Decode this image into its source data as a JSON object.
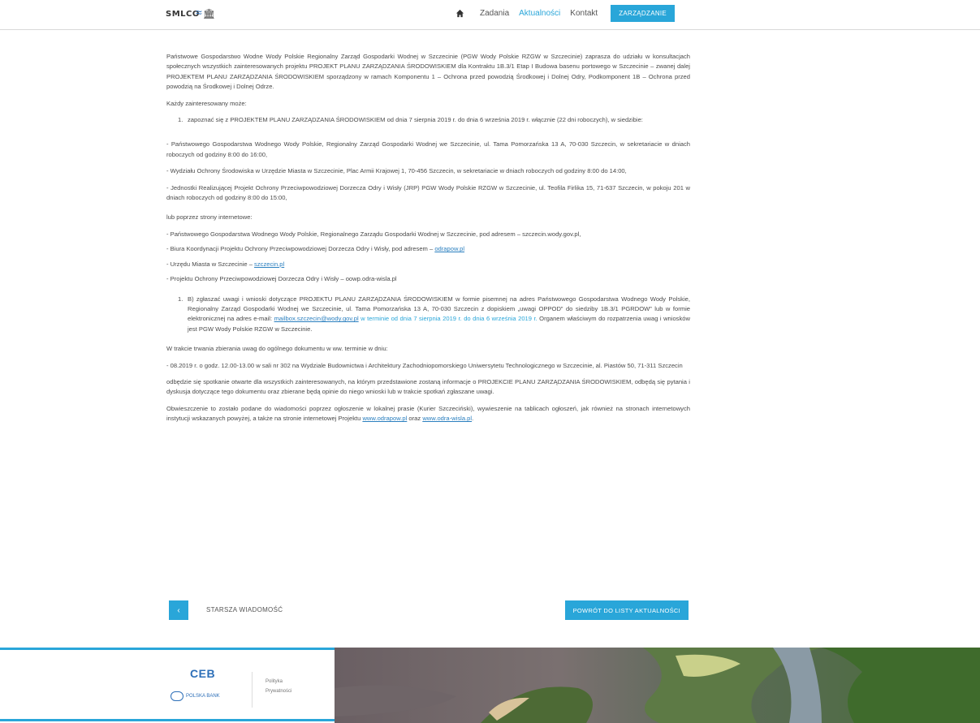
{
  "header": {
    "logo_text": "SMLCO",
    "nav": {
      "items": [
        "Zadania",
        "Aktualności",
        "Kontakt"
      ],
      "active_index": 1,
      "cta_label": "ZARZĄDZANIE"
    }
  },
  "article": {
    "intro": "Państwowe Gospodarstwo Wodne Wody Polskie Regionalny Zarząd Gospodarki Wodnej w Szczecinie (PGW Wody Polskie RZGW w Szczecinie) zaprasza do udziału w konsultacjach społecznych wszystkich zainteresowanych projektu PROJEKT PLANU ZARZĄDZANIA ŚRODOWISKIEM dla Kontraktu 1B.3/1 Etap I Budowa basenu portowego w Szczecinie – zwanej dalej PROJEKTEM PLANU ZARZĄDZANIA ŚRODOWISKIEM sporządzony w ramach Komponentu 1 – Ochrona przed powodzią Środkowej i Dolnej Odry, Podkomponent 1B – Ochrona przed powodzią na Środkowej i Dolnej Odrze.",
    "each_can": "Każdy zainteresowany może:",
    "point1": "zapoznać się z PROJEKTEM PLANU ZARZĄDZANIA ŚRODOWISKIEM od dnia 7 sierpnia 2019 r. do dnia 6 września 2019 r. włącznie (22 dni roboczych), w siedzibie:",
    "loc1": "- Państwowego Gospodarstwa Wodnego Wody Polskie, Regionalny Zarząd Gospodarki Wodnej we Szczecinie, ul. Tama Pomorzańska 13 A, 70-030 Szczecin, w sekretariacie w dniach roboczych od godziny 8:00 do 16:00,",
    "loc2": "- Wydziału Ochrony Środowiska w Urzędzie Miasta w Szczecinie, Plac Armii Krajowej 1, 70-456 Szczecin, w sekretariacie w dniach roboczych od godziny 8:00 do 14:00,",
    "loc3": "- Jednostki Realizującej Projekt Ochrony Przeciwpowodziowej Dorzecza Odry i Wisły (JRP) PGW Wody Polskie RZGW w Szczecinie, ul. Teofila Firlika 15, 71-637 Szczecin, w pokoju 201 w dniach roboczych od godziny 8:00 do 15:00,",
    "web_intro": "lub poprzez strony internetowe:",
    "web1": "- Państwowego Gospodarstwa Wodnego Wody Polskie, Regionalnego Zarządu Gospodarki Wodnej w Szczecinie, pod adresem – szczecin.wody.gov.pl,",
    "web2_prefix": "- Biura Koordynacji Projektu Ochrony Przeciwpowodziowej Dorzecza Odry i Wisły, pod adresem – ",
    "web2_link": "odrapow.pl",
    "web3_prefix": "- Urzędu Miasta w Szczecinie – ",
    "web3_link": "szczecin.pl",
    "web4": "- Projektu Ochrony Przeciwpowodziowej Dorzecza Odry i Wisły – oowp.odra-wisla.pl",
    "point2_a": "B) zgłaszać uwagi i wnioski dotyczące PROJEKTU PLANU ZARZĄDZANIA ŚRODOWISKIEM w formie pisemnej na adres Państwowego Gospodarstwa Wodnego Wody Polskie, Regionalny Zarząd Gospodarki Wodnej we Szczecinie, ul. Tama Pomorzańska 13 A, 70-030 Szczecin z dopiskiem „uwagi OPPOD” do siedziby 1B.3/1 PGRDOW” lub w formie elektronicznej na adres e-mail: ",
    "point2_email": "mailbox.szczecin@wody.gov.pl",
    "point2_b": " w terminie od dnia 7 sierpnia 2019 r. do dnia 6 września 2019 r.",
    "point2_c": " Organem właściwym do rozpatrzenia uwag i wniosków jest PGW Wody Polskie RZGW w Szczecinie.",
    "meeting_intro": "W trakcie trwania zbierania uwag do ogólnego dokumentu w ww. terminie w dniu:",
    "meeting": "- 08.2019 r. o godz. 12.00-13.00 w sali nr 302 na Wydziale Budownictwa i Architektury Zachodniopomorskiego Uniwersytetu Technologicznego w Szczecinie, al. Piastów 50, 71-311 Szczecin",
    "public": "odbędzie się spotkanie otwarte dla wszystkich zainteresowanych, na którym przedstawione zostaną informacje o PROJEKCIE PLANU ZARZĄDZANIA ŚRODOWISKIEM, odbędą się pytania i dyskusja dotyczące tego dokumentu oraz zbierane będą opinie do niego wnioski lub w trakcie spotkań zgłaszane uwagi.",
    "notice_a": "Obwieszczenie to zostało podane do wiadomości poprzez ogłoszenie w lokalnej prasie (Kurier Szczeciński), wywieszenie na tablicach ogłoszeń, jak również na stronach internetowych instytucji wskazanych powyżej, a także na stronie internetowej Projektu ",
    "notice_link1": "www.odrapow.pl",
    "notice_mid": " oraz ",
    "notice_link2": "www.odra-wisla.pl",
    "notice_end": "."
  },
  "pager": {
    "prev_label": "STARSZA WIADOMOŚĆ",
    "back_label": "POWRÓT DO LISTY AKTUALNOŚCI"
  },
  "footer": {
    "cer_logo": "CEB",
    "polska_logo": "POLSKA BANK",
    "links": [
      "Polityka",
      "Prywatności"
    ]
  }
}
